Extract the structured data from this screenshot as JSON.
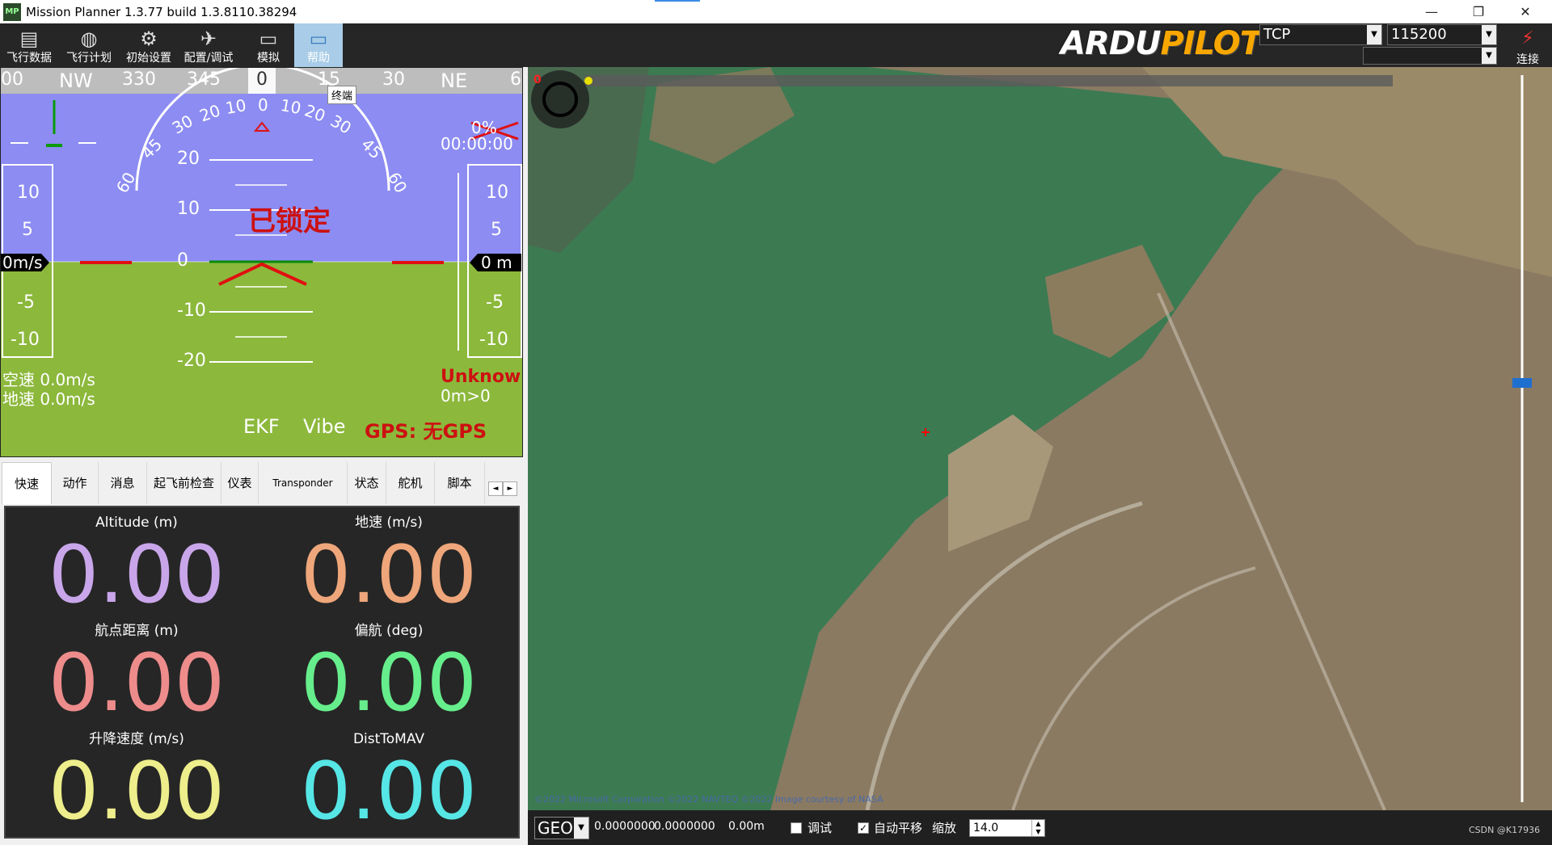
{
  "window": {
    "title": "Mission Planner 1.3.77 build 1.3.8110.38294",
    "icon_text": "MP",
    "controls": [
      "—",
      "❐",
      "✕"
    ]
  },
  "toolbar": {
    "buttons": [
      {
        "label": "飞行数据",
        "icon": "monitor-icon"
      },
      {
        "label": "飞行计划",
        "icon": "globe-icon"
      },
      {
        "label": "初始设置",
        "icon": "gears-icon"
      },
      {
        "label": "配置/调试",
        "icon": "wrench-icon"
      },
      {
        "label": "模拟",
        "icon": "simulation-icon"
      },
      {
        "label": "帮助",
        "icon": "help-icon"
      }
    ],
    "logo": {
      "part1": "ARDU",
      "part2": "PILOT"
    },
    "connection_type": "TCP",
    "baud_rate": "115200",
    "connect_label": "连接",
    "connect_icon": "plug-icon"
  },
  "hud": {
    "compass_labels": [
      "00",
      "NW",
      "330",
      "345",
      "0",
      "15",
      "30",
      "NE",
      "6"
    ],
    "heading_tooltip": "终端",
    "roll_scale": [
      "60",
      "45",
      "30",
      "20",
      "10",
      "0",
      "10",
      "20",
      "30",
      "45",
      "60"
    ],
    "pitch_scale": [
      "20",
      "10",
      "0",
      "-10",
      "-20"
    ],
    "left_tape": [
      "10",
      "5",
      "-5",
      "-10"
    ],
    "right_tape": [
      "10",
      "5",
      "-5",
      "-10"
    ],
    "speed_readout": "0m/s",
    "alt_readout": "0 m",
    "status": "已锁定",
    "battery": "0%",
    "timer": "00:00:00",
    "airspeed": "空速 0.0m/s",
    "groundspeed": "地速 0.0m/s",
    "mode": "Unknown",
    "distance": "0m>0",
    "ekf": "EKF",
    "vibe": "Vibe",
    "gps": "GPS: 无GPS",
    "colors": {
      "sky": "#8c8cf2",
      "ground": "#8cb83c",
      "warning": "#cc1111"
    }
  },
  "tabs": {
    "items": [
      "快速",
      "动作",
      "消息",
      "起飞前检查",
      "仪表",
      "Transponder",
      "状态",
      "舵机",
      "脚本"
    ],
    "active": "快速",
    "arrows": [
      "◄",
      "►"
    ]
  },
  "quick": {
    "items": [
      {
        "label": "Altitude (m)",
        "value": "0.00",
        "color": "#c9a6ea"
      },
      {
        "label": "地速 (m/s)",
        "value": "0.00",
        "color": "#eea67a"
      },
      {
        "label": "航点距离 (m)",
        "value": "0.00",
        "color": "#ee8c8c"
      },
      {
        "label": "偏航 (deg)",
        "value": "0.00",
        "color": "#66ee8c"
      },
      {
        "label": "升降速度 (m/s)",
        "value": "0.00",
        "color": "#eeee8c"
      },
      {
        "label": "DistToMAV",
        "value": "0.00",
        "color": "#56e6e6"
      }
    ]
  },
  "map": {
    "copyright": "©2022 Microsoft Corporation  ©2022 NAVTEQ  ©2022 Image courtesy of NASA",
    "zero_marker": "0",
    "coord_system": "GEO",
    "lat": "0.0000000",
    "lng": "0.0000000",
    "alt": "0.00m",
    "debug_label": "调试",
    "debug_checked": false,
    "autopan_label": "自动平移",
    "autopan_checked": true,
    "zoom_label": "缩放",
    "zoom_value": "14.0",
    "watermark": "CSDN @K17936",
    "colors": {
      "water": "#3c7a52",
      "land": "#8a7a62"
    }
  }
}
